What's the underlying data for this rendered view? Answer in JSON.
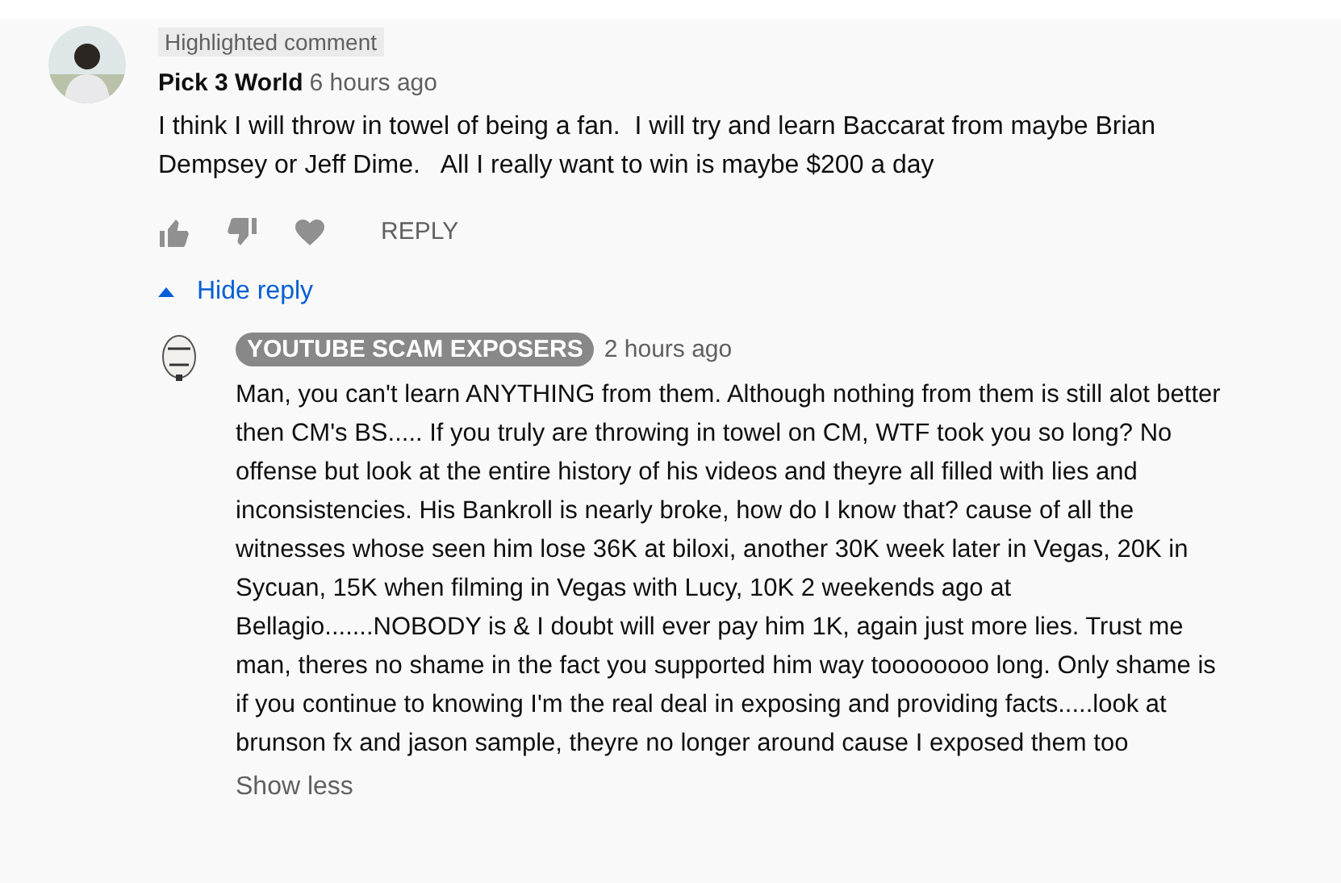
{
  "comment": {
    "badge": "Highlighted comment",
    "author": "Pick 3 World",
    "time": "6 hours ago",
    "text": "I think I will throw in towel of being a fan.  I will try and learn Baccarat from maybe Brian Dempsey or Jeff Dime.   All I really want to win is maybe $200 a day",
    "reply_button": "REPLY"
  },
  "replies_toggle": {
    "label": "Hide reply",
    "expanded": true
  },
  "replies": [
    {
      "author": "YOUTUBE SCAM EXPOSERS",
      "author_highlighted": true,
      "time": "2 hours ago",
      "text": "Man, you can't learn ANYTHING from them. Although nothing from them is still alot better then CM's BS..... If you truly are throwing in towel on CM, WTF took you so long? No offense but look at the entire history of his videos and theyre all filled with lies and inconsistencies. His Bankroll is nearly broke, how do I know that? cause of all the witnesses whose seen him lose 36K at biloxi, another 30K week later in Vegas, 20K in Sycuan, 15K when filming in Vegas with Lucy, 10K 2 weekends ago at Bellagio.......NOBODY is & I doubt will ever pay him 1K, again just more lies. Trust me man, theres no shame in the fact you supported him way toooooooo long. Only shame is if you continue to knowing I'm the real deal in exposing and providing facts.....look at brunson fx and jason sample, theyre no longer around cause I exposed them too",
      "show_less": "Show less"
    }
  ]
}
